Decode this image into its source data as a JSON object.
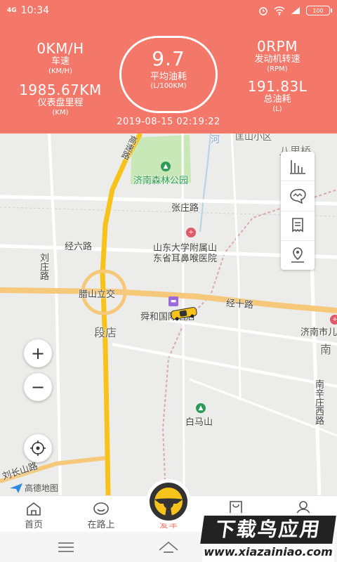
{
  "status_bar": {
    "network": "4G",
    "time": "10:34",
    "battery": "100"
  },
  "dashboard": {
    "speed": {
      "value": "0KM/H",
      "label": "车速",
      "unit": "(KM/H)"
    },
    "odometer": {
      "value": "1985.67KM",
      "label": "仪表盘里程",
      "unit": "(KM)"
    },
    "avg_fuel": {
      "value": "9.7",
      "label": "平均油耗",
      "unit": "(L/100KM)"
    },
    "rpm": {
      "value": "0RPM",
      "label": "发动机转速",
      "unit": "(RPM)"
    },
    "total_fuel": {
      "value": "191.83L",
      "label": "总油耗",
      "unit": "(L)"
    },
    "timestamp": "2019-08-15 02:19:22"
  },
  "map": {
    "labels": {
      "park": "济南森林公园",
      "zhangzhuang_road": "张庄路",
      "jingliu_road": "经六路",
      "hospital_line1": "山东大学附属山",
      "hospital_line2": "东省耳鼻喉医院",
      "liuzhuang_road": "刘庄路",
      "lashan_interchange": "腊山立交",
      "shunhe_hotel": "舜和国际酒店",
      "jingshi_road": "经十路",
      "duandian": "段店",
      "jinan_city": "济南市儿",
      "nan": "南",
      "baima_mountain": "白马山",
      "nanxinzhuang_road": "南辛庄西路",
      "liuchangshan_road": "刘长山路",
      "gaosu_road": "高速路",
      "bali_bridge": "八里桥",
      "top_area": "匡山小区",
      "river": "河"
    },
    "zoom_in": "+",
    "zoom_out": "−",
    "provider": "高德地图",
    "tools": [
      "chart-icon",
      "chat-icon",
      "document-icon",
      "location-pin-icon"
    ]
  },
  "nav": {
    "items": [
      {
        "label": "首页",
        "icon": "home-icon"
      },
      {
        "label": "在路上",
        "icon": "face-icon"
      },
      {
        "label": "爱车",
        "icon": "steering-wheel-icon"
      },
      {
        "label": "商城",
        "icon": "bag-icon"
      },
      {
        "label": "我的",
        "icon": "user-icon"
      }
    ],
    "active": "爱车"
  },
  "watermark": {
    "title": "下载鸟应用",
    "url": "www.xiazainiao.com"
  },
  "colors": {
    "accent": "#f3786a",
    "road_yellow": "#f7c21a",
    "road_orange": "#f5c87a",
    "park_green": "#c9e8b8"
  }
}
